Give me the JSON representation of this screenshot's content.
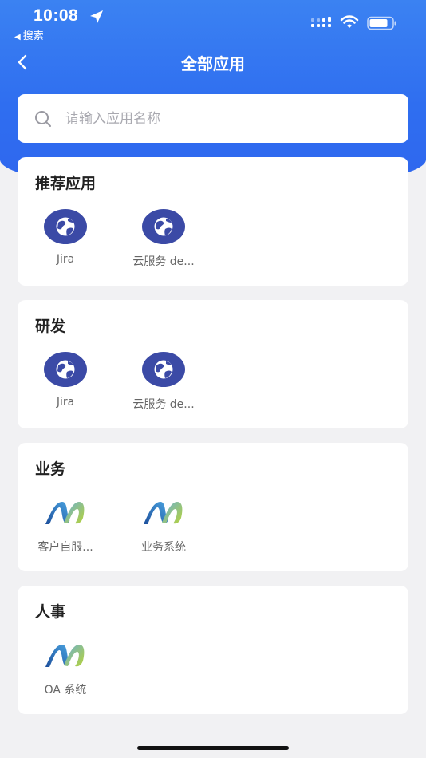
{
  "status_bar": {
    "time": "10:08",
    "back_app": "搜索"
  },
  "nav": {
    "title": "全部应用"
  },
  "search": {
    "placeholder": "请输入应用名称",
    "value": ""
  },
  "sections": [
    {
      "title": "推荐应用",
      "apps": [
        {
          "label": "Jira",
          "icon": "globe-icon"
        },
        {
          "label": "云服务 de...",
          "icon": "globe-icon"
        }
      ]
    },
    {
      "title": "研发",
      "apps": [
        {
          "label": "Jira",
          "icon": "globe-icon"
        },
        {
          "label": "云服务 de...",
          "icon": "globe-icon"
        }
      ]
    },
    {
      "title": "业务",
      "apps": [
        {
          "label": "客户自服...",
          "icon": "brand-logo-icon"
        },
        {
          "label": "业务系统",
          "icon": "brand-logo-icon"
        }
      ]
    },
    {
      "title": "人事",
      "apps": [
        {
          "label": "OA 系统",
          "icon": "brand-logo-icon"
        }
      ]
    }
  ],
  "colors": {
    "header_blue": "#2f6ef0",
    "globe_fill": "#3b4aa6",
    "logo_blue": "#2b66c7",
    "logo_green": "#a3c93a"
  }
}
